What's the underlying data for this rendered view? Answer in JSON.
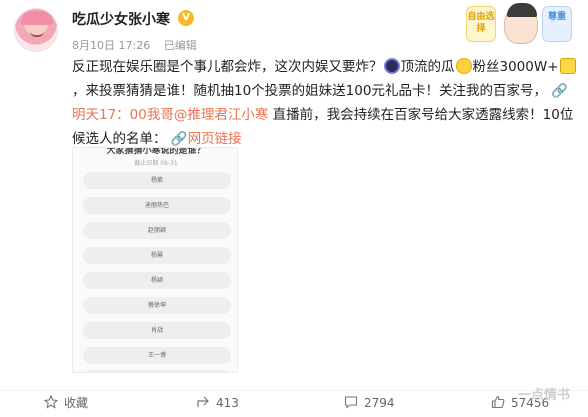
{
  "post": {
    "username": "吃瓜少女张小寒",
    "badge": "V",
    "date": "8月10日 17:26",
    "edited": "已编辑",
    "text_1": "反正现在娱乐圈是个事儿都会炸，这次内娱又要炸？",
    "text_2": "顶流的瓜",
    "text_3": "粉丝3000W+",
    "text_4": "，来投票猜猜是谁！随机抽10个投票的姐妹送100元礼品卡！关注我的百家号，",
    "mention_link": "明天17：00我哥@推理君江小寒",
    "text_5": "直播前，我会持续在百家号给大家透露线索！10位候选人的名单：",
    "web_link": "网页链接"
  },
  "sticker": {
    "left_text": "自由选择",
    "right_text": "尊重"
  },
  "poll": {
    "title": "大家猜猜小寒说的是谁？",
    "subtitle": "截止日期 08-31",
    "options": [
      "杨紫",
      "迪丽热巴",
      "赵丽颖",
      "杨幂",
      "杨颖",
      "蔡徐坤",
      "肖战",
      "王一博",
      "杨洋"
    ]
  },
  "actions": {
    "favorite": "收藏",
    "shares": "413",
    "comments": "2794",
    "likes": "57456"
  },
  "watermark": "一点情书"
}
